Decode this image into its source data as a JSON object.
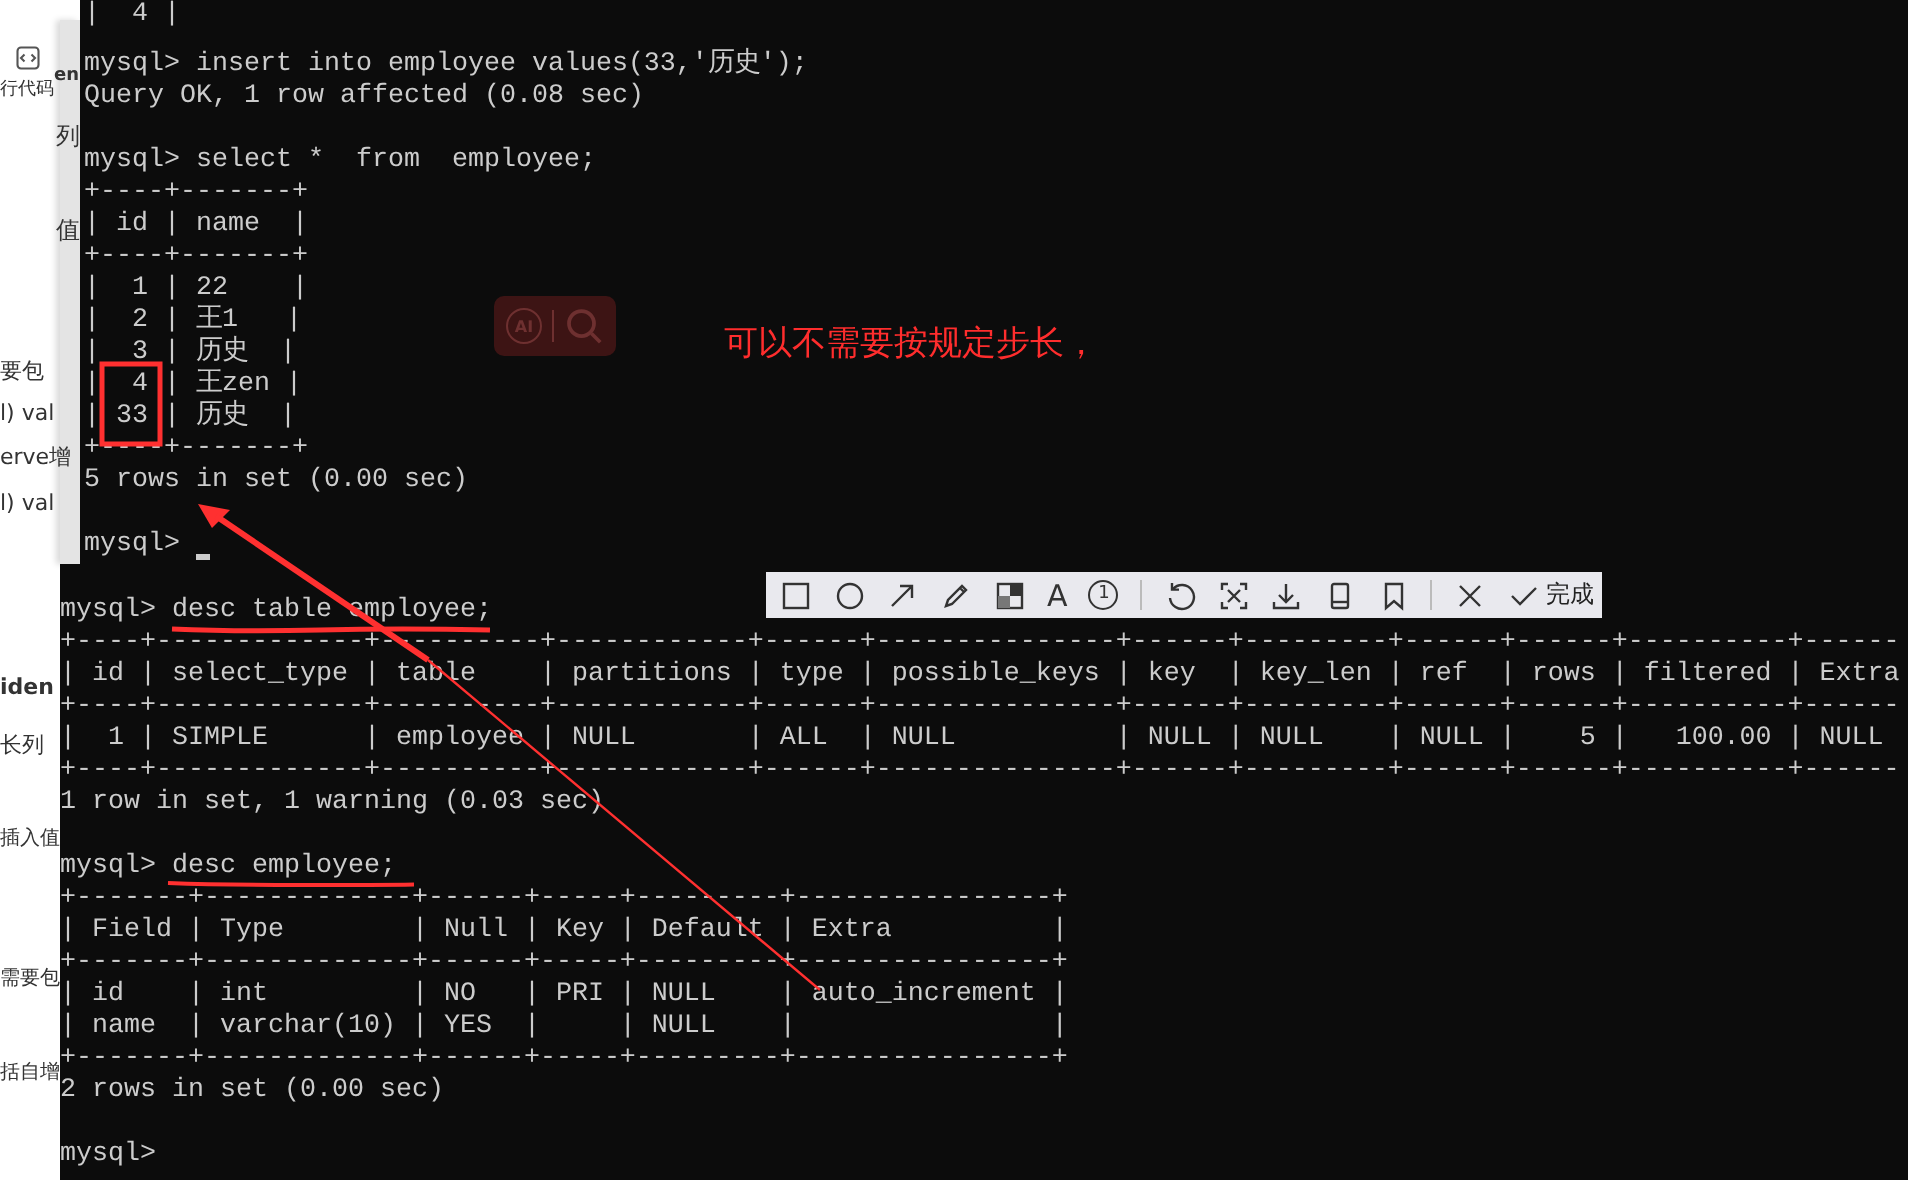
{
  "background_page": {
    "fragments": [
      {
        "text": "行代码",
        "kind": "button"
      },
      {
        "text": "en",
        "kind": "heading"
      },
      {
        "text": "列",
        "kind": "text"
      },
      {
        "text": "值",
        "kind": "text"
      },
      {
        "text": "要包",
        "kind": "text"
      },
      {
        "text": "l) val",
        "kind": "text"
      },
      {
        "text": "erve增",
        "kind": "text"
      },
      {
        "text": "l) val",
        "kind": "text"
      },
      {
        "text": "iden",
        "kind": "heading"
      },
      {
        "text": "长列",
        "kind": "text"
      },
      {
        "text": "插入值",
        "kind": "text"
      },
      {
        "text": "需要包",
        "kind": "text"
      },
      {
        "text": "括自增",
        "kind": "text"
      }
    ]
  },
  "top_terminal": {
    "cursor": true,
    "lines": [
      {
        "kind": "table",
        "text": "|  4 |"
      },
      {
        "kind": "prompt",
        "text": "mysql> insert into employee values(33,'历史');"
      },
      {
        "kind": "output",
        "text": "Query OK, 1 row affected (0.08 sec)"
      },
      {
        "kind": "prompt",
        "text": "mysql> select *  from  employee;"
      },
      {
        "kind": "table",
        "text": "+----+-------+"
      },
      {
        "kind": "table",
        "text": "| id | name  |"
      },
      {
        "kind": "table",
        "text": "+----+-------+"
      },
      {
        "kind": "table",
        "text": "|  1 | 22    |"
      },
      {
        "kind": "table",
        "text": "|  2 | 王1   |"
      },
      {
        "kind": "table",
        "text": "|  3 | 历史  |"
      },
      {
        "kind": "table",
        "text": "|  4 | 王zen |"
      },
      {
        "kind": "table",
        "text": "| 33 | 历史  |"
      },
      {
        "kind": "table",
        "text": "+----+-------+"
      },
      {
        "kind": "output",
        "text": "5 rows in set (0.00 sec)"
      },
      {
        "kind": "prompt",
        "text": "mysql>"
      }
    ]
  },
  "overlay_badge": {
    "label": "AI"
  },
  "annotation": {
    "note": "可以不需要按规定步长，"
  },
  "screenshot_toolbar": {
    "tools": [
      {
        "kind": "rectangle"
      },
      {
        "kind": "ellipse"
      },
      {
        "kind": "arrow"
      },
      {
        "kind": "pencil"
      },
      {
        "kind": "mosaic"
      },
      {
        "kind": "text",
        "label": "A"
      },
      {
        "kind": "number",
        "label": "1"
      },
      {
        "kind": "separator"
      },
      {
        "kind": "undo"
      },
      {
        "kind": "ocr"
      },
      {
        "kind": "download"
      },
      {
        "kind": "phone"
      },
      {
        "kind": "bookmark"
      },
      {
        "kind": "separator"
      },
      {
        "kind": "close"
      },
      {
        "kind": "done",
        "label": "完成"
      }
    ]
  },
  "bottom_terminal": {
    "cursor": false,
    "lines": [
      {
        "kind": "prompt",
        "text": "mysql> desc table employee;"
      },
      {
        "kind": "table",
        "text": "+----+-------------+----------+------------+------+---------------+------+---------+------+------+----------+------"
      },
      {
        "kind": "table",
        "text": "| id | select_type | table    | partitions | type | possible_keys | key  | key_len | ref  | rows | filtered | Extra"
      },
      {
        "kind": "table",
        "text": "+----+-------------+----------+------------+------+---------------+------+---------+------+------+----------+------"
      },
      {
        "kind": "table",
        "text": "|  1 | SIMPLE      | employee | NULL       | ALL  | NULL          | NULL | NULL    | NULL |    5 |   100.00 | NULL"
      },
      {
        "kind": "table",
        "text": "+----+-------------+----------+------------+------+---------------+------+---------+------+------+----------+------"
      },
      {
        "kind": "output",
        "text": "1 row in set, 1 warning (0.03 sec)"
      },
      {
        "kind": "prompt",
        "text": "mysql> desc employee;"
      },
      {
        "kind": "table",
        "text": "+-------+-------------+------+-----+---------+----------------+"
      },
      {
        "kind": "table",
        "text": "| Field | Type        | Null | Key | Default | Extra          |"
      },
      {
        "kind": "table",
        "text": "+-------+-------------+------+-----+---------+----------------+"
      },
      {
        "kind": "table",
        "text": "| id    | int         | NO   | PRI | NULL    | auto_increment |"
      },
      {
        "kind": "table",
        "text": "| name  | varchar(10) | YES  |     | NULL    |                |"
      },
      {
        "kind": "table",
        "text": "+-------+-------------+------+-----+---------+----------------+"
      },
      {
        "kind": "output",
        "text": "2 rows in set (0.00 sec)"
      },
      {
        "kind": "prompt",
        "text": "mysql>"
      }
    ]
  }
}
